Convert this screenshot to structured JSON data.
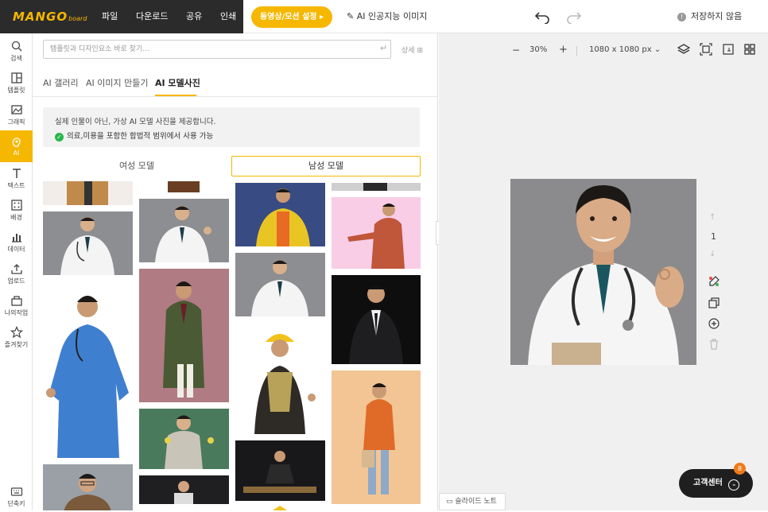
{
  "header": {
    "logo_main": "MANGO",
    "logo_sub": "board",
    "menu": [
      "파일",
      "다운로드",
      "공유",
      "인쇄"
    ],
    "motion_button": "동영상/모션 설정 ▸",
    "ai_image": "AI 인공지능 이미지",
    "save_status": "저장하지 않음"
  },
  "sidebar": {
    "items": [
      {
        "label": "검색",
        "icon": "search-icon"
      },
      {
        "label": "템플릿",
        "icon": "template-icon"
      },
      {
        "label": "그래픽",
        "icon": "graphic-icon"
      },
      {
        "label": "AI",
        "icon": "ai-icon"
      },
      {
        "label": "텍스트",
        "icon": "text-icon"
      },
      {
        "label": "배경",
        "icon": "background-icon"
      },
      {
        "label": "데이터",
        "icon": "data-icon"
      },
      {
        "label": "업로드",
        "icon": "upload-icon"
      },
      {
        "label": "나의작업",
        "icon": "my-work-icon"
      },
      {
        "label": "즐겨찾기",
        "icon": "star-icon"
      }
    ],
    "shortcut": "단축키"
  },
  "panel": {
    "search_placeholder": "템플릿과 디자인요소 바로 찾기...",
    "detail": "상세",
    "tabs": [
      "AI 갤러리",
      "AI 이미지 만들기",
      "AI 모델사진"
    ],
    "notice_line1": "실제 인물이 아닌, 가상 AI 모델 사진을 제공합니다.",
    "notice_line2": "의료,미용을 포함한 합법적 범위에서 사용 가능",
    "gender_female": "여성 모델",
    "gender_male": "남성 모델"
  },
  "canvas": {
    "zoom": "30%",
    "size": "1080 x 1080 px",
    "page_number": "1",
    "slide_note": "슬라이드 노트"
  },
  "support": {
    "label": "고객센터",
    "badge": "8"
  }
}
